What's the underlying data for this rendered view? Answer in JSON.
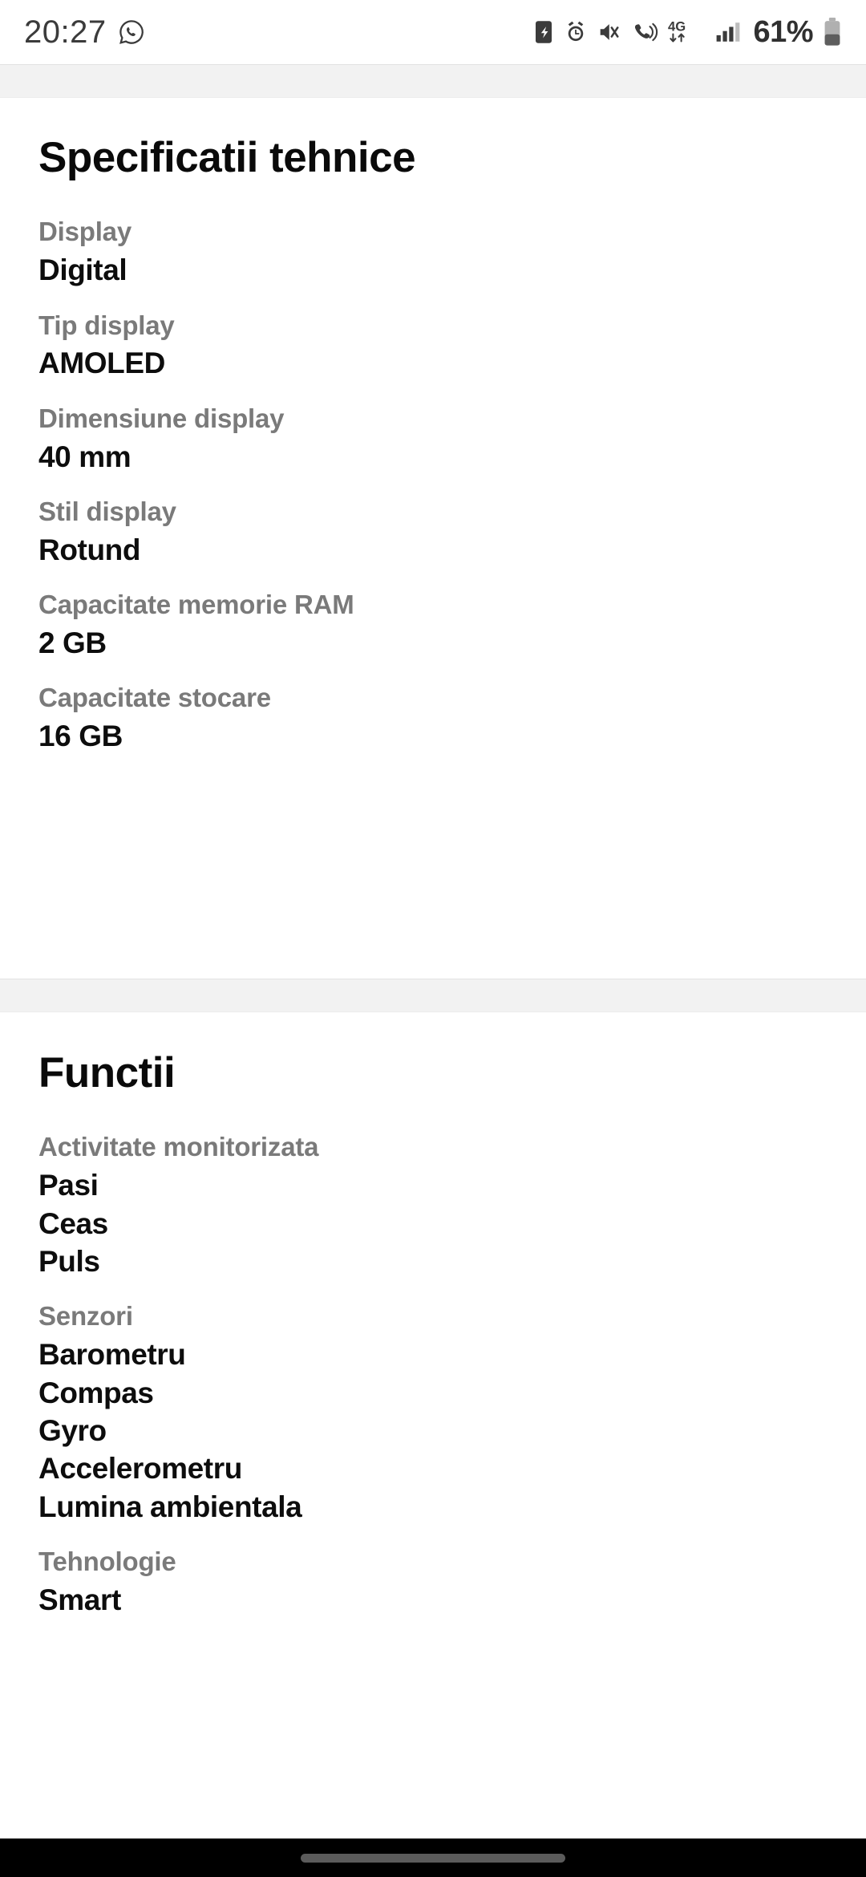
{
  "status_bar": {
    "time": "20:27",
    "left_icons": [
      "whatsapp-icon"
    ],
    "right_icons": [
      "screen-record-icon",
      "alarm-clock-icon",
      "sound-mute-vibrate-icon",
      "call-ringing-icon",
      "network-4g-icon",
      "signal-bars-icon"
    ],
    "network_label": "4G",
    "battery_percent": "61%",
    "colors": {
      "text": "#3b3b3b",
      "background": "#ffffff"
    }
  },
  "sections": [
    {
      "title": "Specificatii tehnice",
      "rows": [
        {
          "label": "Display",
          "values": [
            "Digital"
          ]
        },
        {
          "label": "Tip display",
          "values": [
            "AMOLED"
          ]
        },
        {
          "label": "Dimensiune display",
          "values": [
            "40 mm"
          ]
        },
        {
          "label": "Stil display",
          "values": [
            "Rotund"
          ]
        },
        {
          "label": "Capacitate memorie RAM",
          "values": [
            "2 GB"
          ]
        },
        {
          "label": "Capacitate stocare",
          "values": [
            "16 GB"
          ]
        }
      ]
    },
    {
      "title": "Functii",
      "rows": [
        {
          "label": "Activitate monitorizata",
          "values": [
            "Pasi",
            "Ceas",
            "Puls"
          ]
        },
        {
          "label": "Senzori",
          "values": [
            "Barometru",
            "Compas",
            "Gyro",
            "Accelerometru",
            "Lumina ambientala"
          ]
        },
        {
          "label": "Tehnologie",
          "values": [
            "Smart"
          ]
        }
      ]
    }
  ],
  "navigation_bar": {
    "gesture_pill": "home-gesture-pill",
    "background": "#000000"
  },
  "theme": {
    "label_color": "#7a7a7a",
    "value_color": "#0d0d0d",
    "divider_color": "#f2f2f2"
  }
}
